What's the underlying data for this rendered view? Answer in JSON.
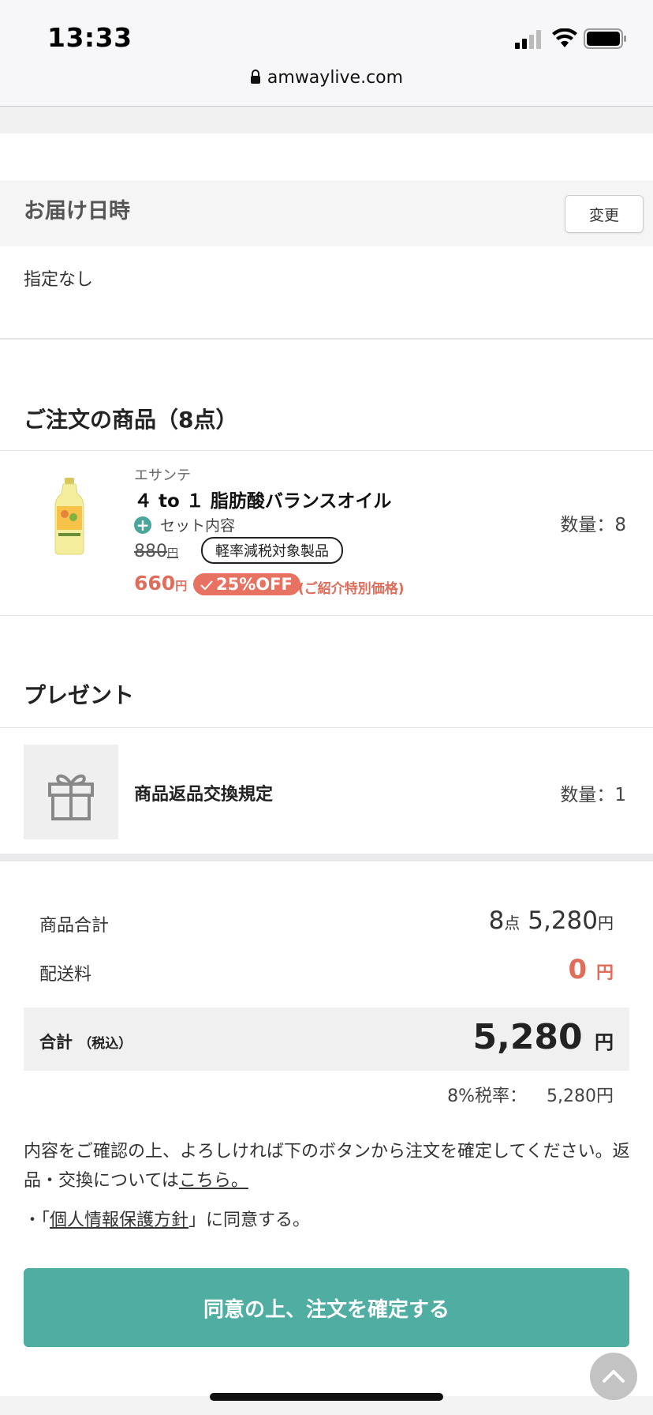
{
  "status": {
    "time": "13:33",
    "url": "amwaylive.com"
  },
  "delivery": {
    "title": "お届け日時",
    "change_label": "変更",
    "value": "指定なし"
  },
  "order": {
    "title": "ご注文の商品（8点）",
    "item": {
      "brand": "エサンテ",
      "name": "４ to １ 脂肪酸バランスオイル",
      "set_label": "セット内容",
      "old_price": "880",
      "yen": "円",
      "tax_badge": "軽率減税対象製品",
      "new_price": "660",
      "off_badge": "25%OFF",
      "special_note": "(ご紹介特別価格)",
      "quantity": "数量：8"
    }
  },
  "present": {
    "title": "プレゼント",
    "item_label": "商品返品交換規定",
    "quantity": "数量：1"
  },
  "summary": {
    "subtotal_label": "商品合計",
    "subtotal_count": "8",
    "subtotal_count_unit": "点",
    "subtotal_amount": "5,280",
    "yen": "円",
    "shipping_label": "配送料",
    "shipping_amount": "0",
    "total_label": "合計",
    "total_tax_note": "（税込）",
    "total_amount": "5,280",
    "tax_rate_label": "8%税率：",
    "tax_rate_amount": "5,280円"
  },
  "confirm": {
    "text": "内容をご確認の上、よろしければ下のボタンから注文を確定してください。返品・交換については",
    "link": "こちら。",
    "policy_prefix": "・「",
    "policy_link": "個人情報保護方針",
    "policy_suffix": "」に同意する。",
    "button": "同意の上、注文を確定する"
  }
}
